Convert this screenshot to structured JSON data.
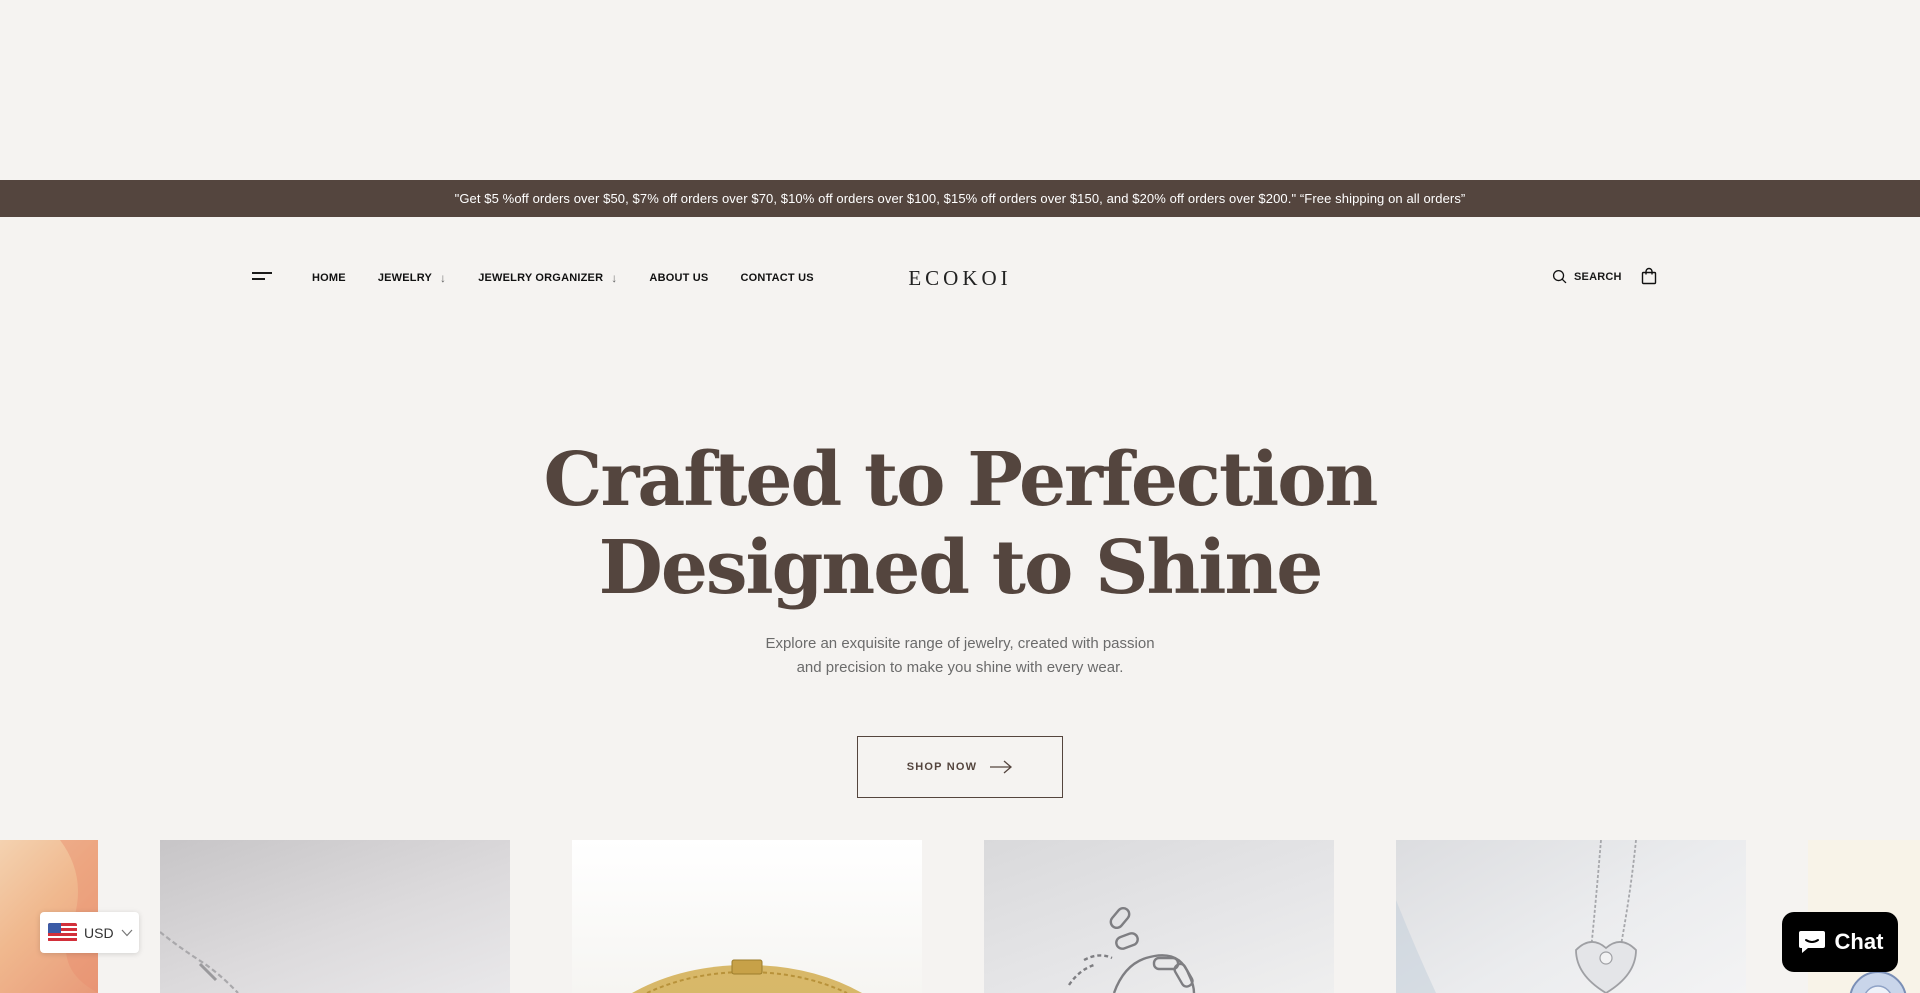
{
  "announcement": "\"Get $5 %off orders over $50, $7% off orders over $70, $10% off orders over $100, $15% off orders over $150, and $20% off orders over $200.\" “Free shipping on all orders”",
  "header": {
    "logo": "ECOKOI",
    "nav": [
      {
        "label": "HOME",
        "has_dropdown": false
      },
      {
        "label": "JEWELRY",
        "has_dropdown": true
      },
      {
        "label": "JEWELRY ORGANIZER",
        "has_dropdown": true
      },
      {
        "label": "ABOUT US",
        "has_dropdown": false
      },
      {
        "label": "CONTACT US",
        "has_dropdown": false
      }
    ],
    "dropdown_glyph": "↓",
    "search_label": "SEARCH",
    "icons": {
      "menu": "hamburger-icon",
      "search": "search-icon",
      "cart": "shopping-bag-icon"
    }
  },
  "hero": {
    "title_line1": "Crafted to Perfection",
    "title_line2": "Designed to Shine",
    "subtitle_line1": "Explore an exquisite range of jewelry, created with passion",
    "subtitle_line2": "and precision to make you shine with every wear.",
    "cta_label": "SHOP NOW"
  },
  "currency": {
    "code": "USD",
    "flag": "us-flag-icon"
  },
  "chat": {
    "label": "Chat"
  },
  "colors": {
    "background": "#f5f3f1",
    "brand_brown": "#54453e",
    "announcement_text": "#ffffff",
    "chat_bg": "#000000"
  }
}
